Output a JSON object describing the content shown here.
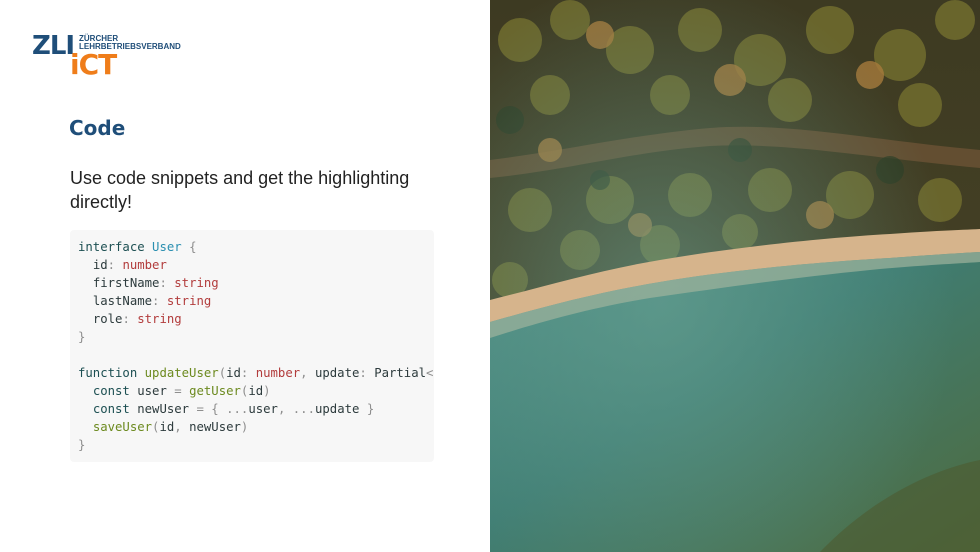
{
  "logo": {
    "mark_top": "ZLI",
    "mark_bottom": "iCT",
    "line1": "ZÜRCHER",
    "line2": "LEHRBETRIEBSVERBAND",
    "colors": {
      "blue": "#1f4e79",
      "orange": "#ef7d1a"
    }
  },
  "slide": {
    "title": "Code",
    "lead": "Use code snippets and get the highlighting directly!"
  },
  "code_lines": [
    "interface User {",
    "  id: number",
    "  firstName: string",
    "  lastName: string",
    "  role: string",
    "}",
    "",
    "function updateUser(id: number, update: Partial<User>) {",
    "  const user = getUser(id)",
    "  const newUser = { ...user, ...update }",
    "  saveUser(id, newUser)",
    "}"
  ],
  "image": {
    "icon": "aerial-forest-lake-photo"
  }
}
